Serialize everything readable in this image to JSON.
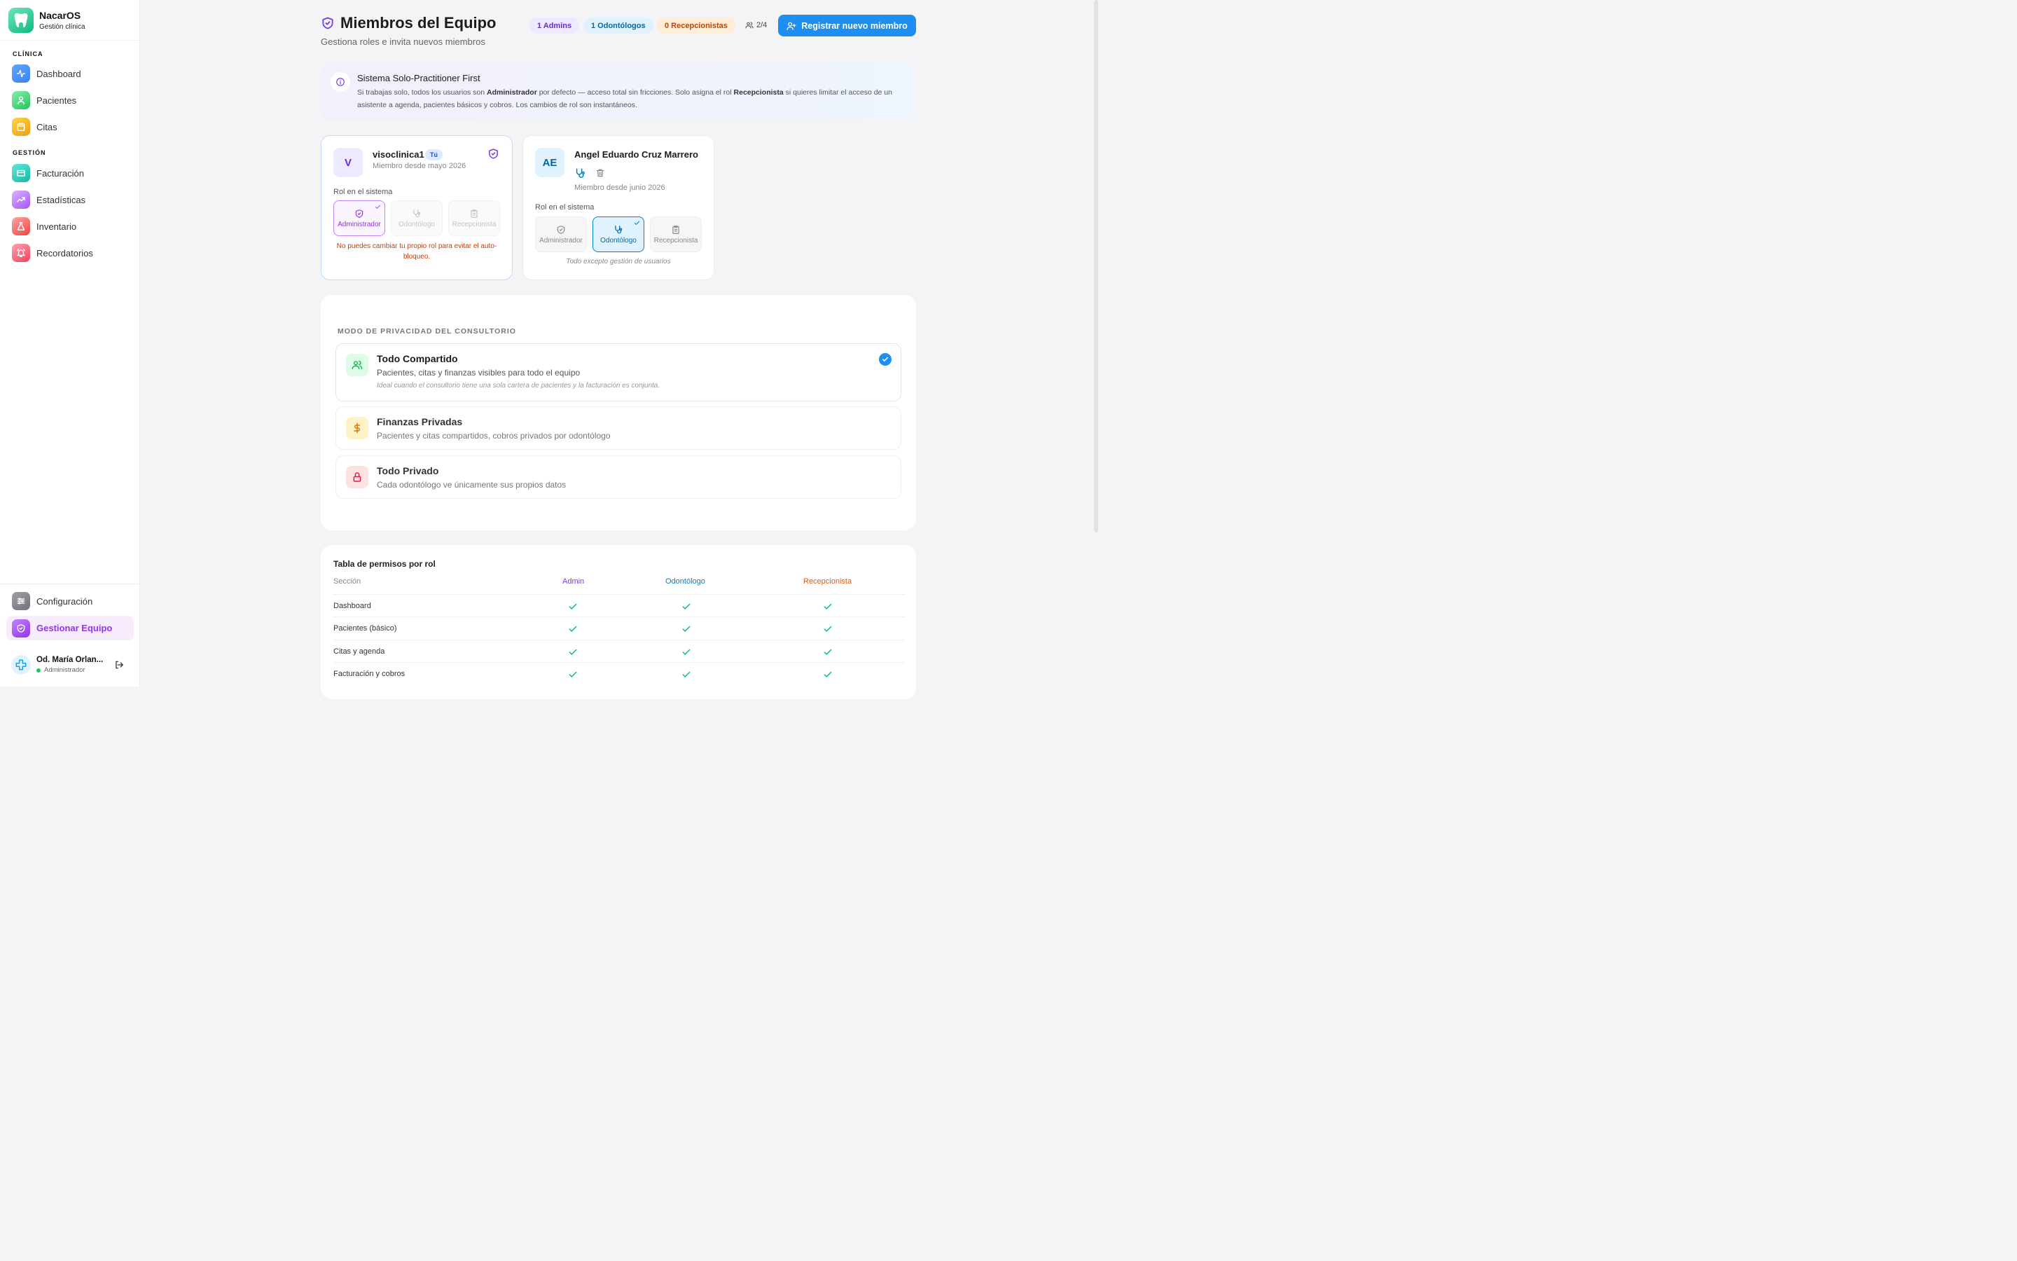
{
  "app": {
    "name": "NacarOS",
    "subtitle": "Gestión clínica"
  },
  "sidebar": {
    "section_clinica": "CLÍNICA",
    "section_gestion": "GESTIÓN",
    "items": [
      {
        "label": "Dashboard",
        "icon": "activity-icon"
      },
      {
        "label": "Pacientes",
        "icon": "user-icon"
      },
      {
        "label": "Citas",
        "icon": "calendar-icon"
      },
      {
        "label": "Facturación",
        "icon": "credit-card-icon"
      },
      {
        "label": "Estadísticas",
        "icon": "trending-up-icon"
      },
      {
        "label": "Inventario",
        "icon": "flask-icon"
      },
      {
        "label": "Recordatorios",
        "icon": "alarm-icon"
      },
      {
        "label": "Configuración",
        "icon": "sliders-icon"
      },
      {
        "label": "Gestionar Equipo",
        "icon": "shield-icon"
      }
    ],
    "user": {
      "name": "Od. María Orlan...",
      "role": "Administrador"
    }
  },
  "header": {
    "title": "Miembros del Equipo",
    "subtitle": "Gestiona roles e invita nuevos miembros",
    "badges": {
      "admins": "1 Admins",
      "odontologos": "1 Odontólogos",
      "recepcionistas": "0 Recepcionistas",
      "count": "2/4"
    },
    "register_button": "Registrar nuevo miembro"
  },
  "info": {
    "title": "Sistema Solo-Practitioner First",
    "text_1": "Si trabajas solo, todos los usuarios son ",
    "strong_1": "Administrador",
    "text_2": " por defecto — acceso total sin fricciones. Solo asigna el rol ",
    "strong_2": "Recepcionista",
    "text_3": " si quieres limitar el acceso de un asistente a agenda, pacientes básicos y cobros. Los cambios de rol son instantáneos."
  },
  "members": [
    {
      "initials": "V",
      "name": "visoclinica1",
      "badge": "Tú",
      "since": "Miembro desde mayo 2026",
      "role_label": "Rol en el sistema",
      "roles": [
        "Administrador",
        "Odontólogo",
        "Recepcionista"
      ],
      "selected": "Administrador",
      "warning": "No puedes cambiar tu propio rol para evitar el auto-bloqueo."
    },
    {
      "initials": "AE",
      "name": "Angel Eduardo Cruz Marrero",
      "since": "Miembro desde junio 2026",
      "role_label": "Rol en el sistema",
      "roles": [
        "Administrador",
        "Odontólogo",
        "Recepcionista"
      ],
      "selected": "Odontólogo",
      "note": "Todo excepto gestión de usuarios"
    }
  ],
  "privacy": {
    "heading": "MODO DE PRIVACIDAD DEL CONSULTORIO",
    "options": [
      {
        "title": "Todo Compartido",
        "desc": "Pacientes, citas y finanzas visibles para todo el equipo",
        "note": "Ideal cuando el consultorio tiene una sola cartera de pacientes y la facturación es conjunta.",
        "selected": true
      },
      {
        "title": "Finanzas Privadas",
        "desc": "Pacientes y citas compartidos, cobros privados por odontólogo",
        "selected": false
      },
      {
        "title": "Todo Privado",
        "desc": "Cada odontólogo ve únicamente sus propios datos",
        "selected": false
      }
    ]
  },
  "permissions": {
    "title": "Tabla de permisos por rol",
    "columns": [
      "Sección",
      "Admin",
      "Odontólogo",
      "Recepcionista"
    ],
    "rows": [
      {
        "section": "Dashboard",
        "admin": true,
        "odontologo": true,
        "recepcionista": true
      },
      {
        "section": "Pacientes (básico)",
        "admin": true,
        "odontologo": true,
        "recepcionista": true
      },
      {
        "section": "Citas y agenda",
        "admin": true,
        "odontologo": true,
        "recepcionista": true
      },
      {
        "section": "Facturación y cobros",
        "admin": true,
        "odontologo": true,
        "recepcionista": true
      }
    ]
  },
  "colors": {
    "primary": "#1e8ff0",
    "admin": "#7c3aed",
    "odontologo": "#0284c7",
    "recepcionista": "#ea580c",
    "success": "#10b981"
  }
}
